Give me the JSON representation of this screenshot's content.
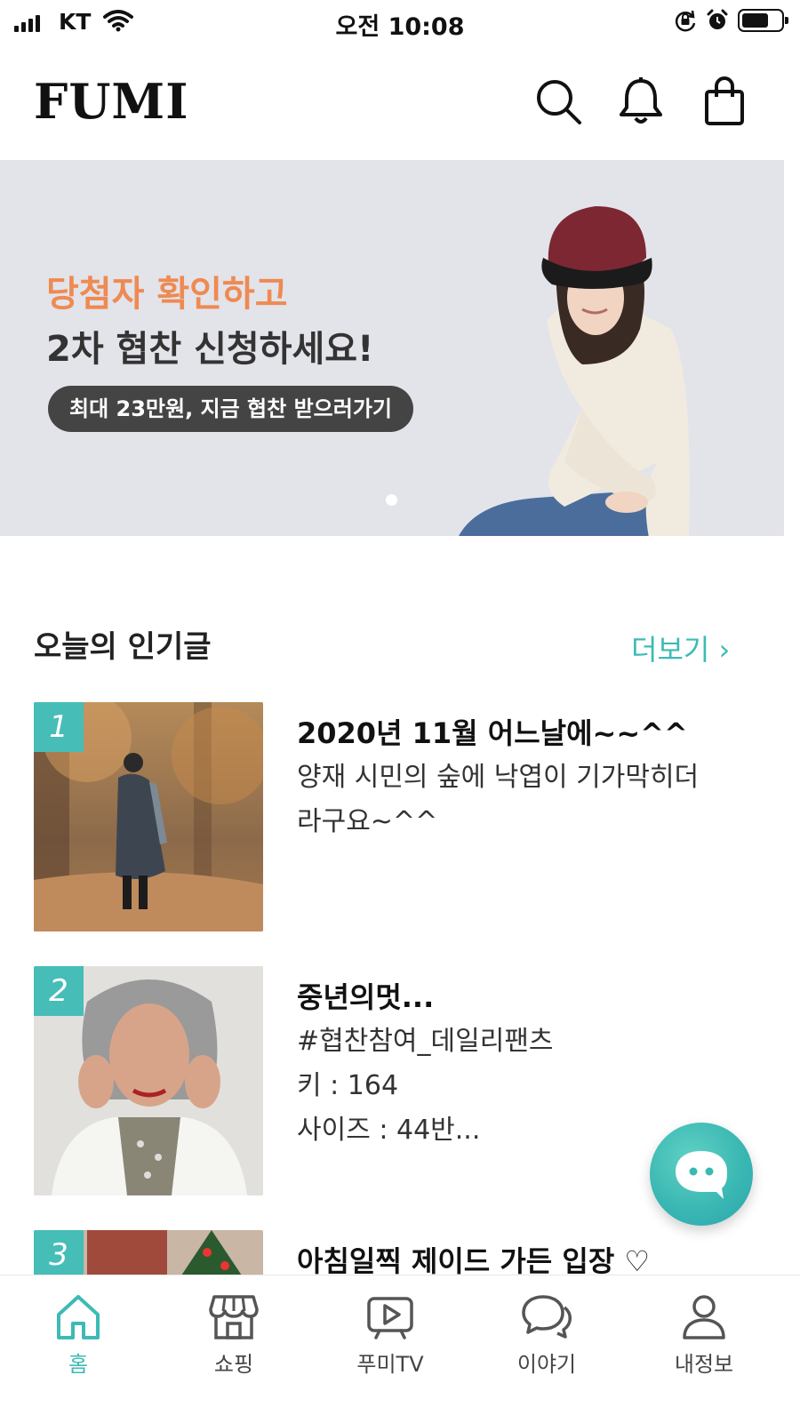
{
  "status_bar": {
    "carrier": "KT",
    "time": "오전 10:08"
  },
  "header": {
    "logo": "FUMI"
  },
  "banner": {
    "line1": "당첨자 확인하고",
    "line2": "2차 협찬 신청하세요!",
    "cta": "최대 23만원, 지금 협찬 받으러가기"
  },
  "section": {
    "title": "오늘의 인기글",
    "more": "더보기 ›"
  },
  "posts": [
    {
      "rank": "1",
      "title": "2020년 11월 어느날에~~^^",
      "body": "양재 시민의 숲에 낙엽이 기가막히더\n라구요~^^"
    },
    {
      "rank": "2",
      "title": "중년의멋...",
      "body": "#협찬참여_데일리팬츠\n키 : 164\n사이즈 : 44반..."
    },
    {
      "rank": "3",
      "title": "아침일찍 제이드 가든 입장 ♡",
      "body": ""
    }
  ],
  "nav": [
    {
      "label": "홈",
      "icon": "home-icon",
      "active": true
    },
    {
      "label": "쇼핑",
      "icon": "store-icon"
    },
    {
      "label": "푸미TV",
      "icon": "tv-icon"
    },
    {
      "label": "이야기",
      "icon": "chat-icon"
    },
    {
      "label": "내정보",
      "icon": "profile-icon"
    }
  ],
  "colors": {
    "accent": "#3dbab6",
    "banner_highlight": "#ee8a52",
    "banner_bg": "#e3e3ea"
  }
}
